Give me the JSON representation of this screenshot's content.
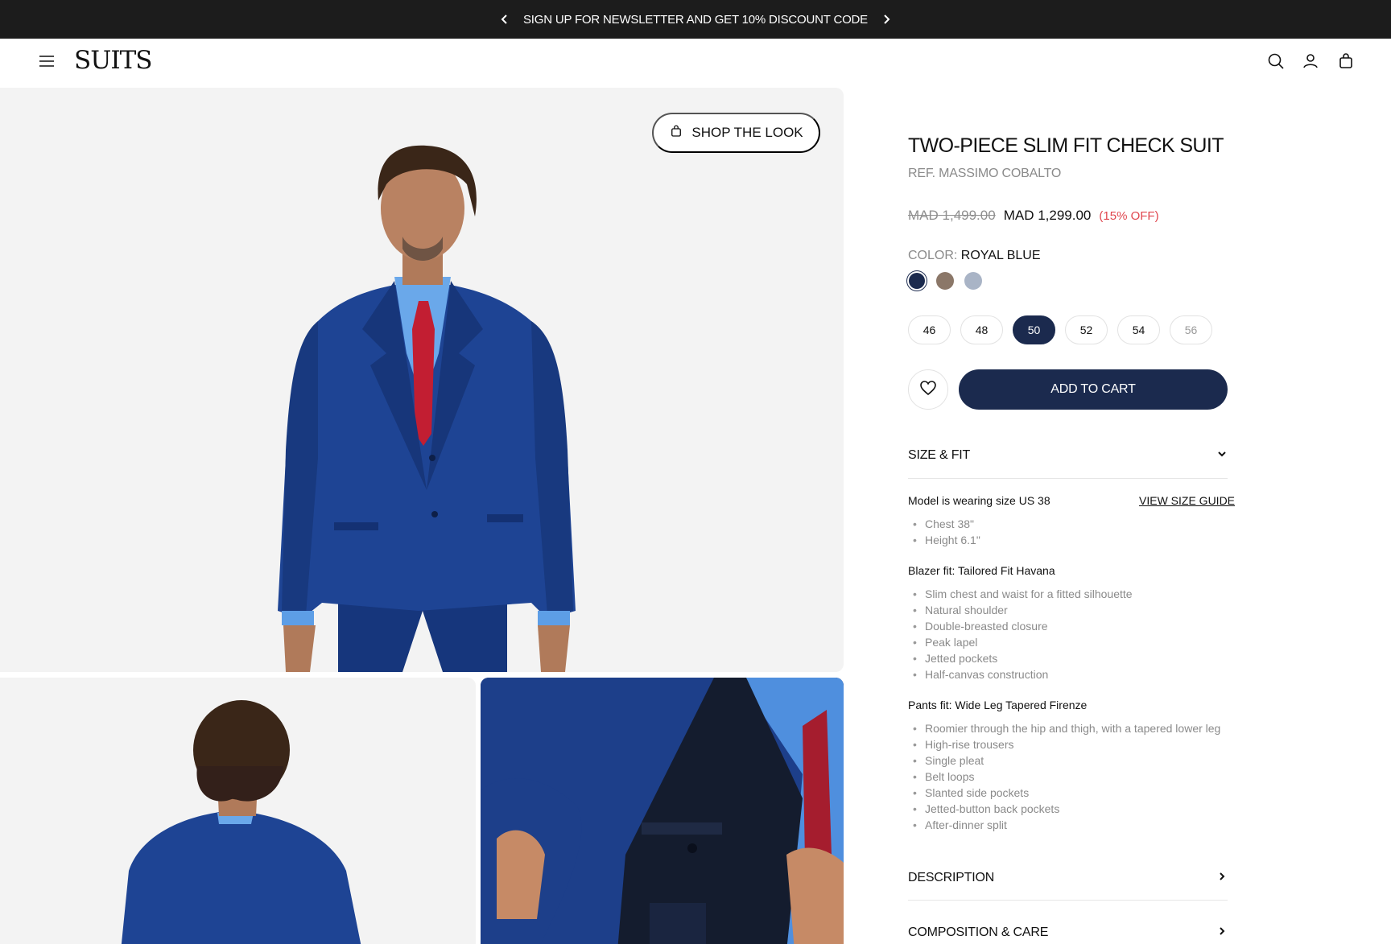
{
  "announcement": {
    "text": "SIGN UP FOR NEWSLETTER AND GET 10% DISCOUNT CODE",
    "prev_icon": "chevron-left-icon",
    "next_icon": "chevron-right-icon"
  },
  "header": {
    "logo": "SUITS",
    "icons": [
      "menu-icon",
      "search-icon",
      "account-icon",
      "bag-icon"
    ]
  },
  "gallery": {
    "shop_the_look_label": "SHOP THE LOOK",
    "shop_icon": "bag-icon"
  },
  "product": {
    "title": "TWO-PIECE SLIM FIT CHECK SUIT",
    "ref": "REF. MASSIMO COBALTO",
    "price_currency": "MAD",
    "price_old_value": "1,499.00",
    "price_new": "MAD 1,299.00",
    "discount": "(15% OFF)",
    "color_label": "COLOR:",
    "color_value": "ROYAL BLUE",
    "swatches": [
      {
        "color": "#1b2a4e",
        "selected": true
      },
      {
        "color": "#8b7768",
        "selected": false
      },
      {
        "color": "#a9b4c6",
        "selected": false
      }
    ],
    "sizes": [
      {
        "label": "46",
        "state": "available"
      },
      {
        "label": "48",
        "state": "available"
      },
      {
        "label": "50",
        "state": "selected"
      },
      {
        "label": "52",
        "state": "available"
      },
      {
        "label": "54",
        "state": "available"
      },
      {
        "label": "56",
        "state": "unavailable"
      }
    ],
    "add_to_cart_label": "ADD TO CART",
    "wishlist_icon": "heart-icon"
  },
  "size_fit": {
    "label": "SIZE & FIT",
    "model_text": "Model is wearing size US 38",
    "size_guide_label": "VIEW SIZE GUIDE",
    "model_bullets": [
      "Chest 38\"",
      "Height 6.1\""
    ],
    "blazer_heading": "Blazer fit: Tailored Fit Havana",
    "blazer_bullets": [
      "Slim chest and waist for a fitted silhouette",
      "Natural shoulder",
      "Double-breasted closure",
      "Peak lapel",
      "Jetted pockets",
      "Half-canvas construction"
    ],
    "pants_heading": "Pants fit: Wide Leg Tapered Firenze",
    "pants_bullets": [
      "Roomier through the hip and thigh, with a tapered lower leg",
      "High-rise trousers",
      "Single pleat",
      "Belt loops",
      "Slanted side pockets",
      "Jetted-button back pockets",
      "After-dinner split"
    ]
  },
  "accordions": {
    "description_label": "DESCRIPTION",
    "composition_label": "COMPOSITION & CARE"
  },
  "colors": {
    "accent": "#1b2a4e",
    "announcement_bg": "#1c1c1c",
    "discount": "#e0464e",
    "suit_blue": "#1d3f8a"
  }
}
